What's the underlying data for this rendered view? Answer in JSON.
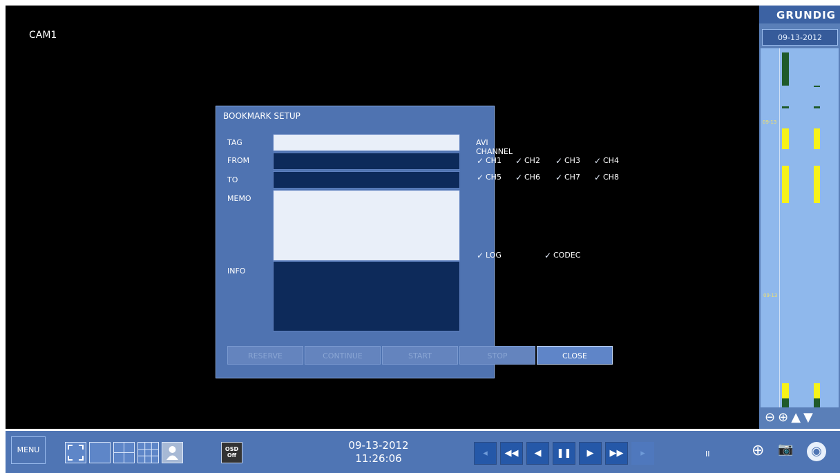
{
  "camera": {
    "label": "CAM1"
  },
  "brand": {
    "name": "GRUNDIG"
  },
  "timeline": {
    "date": "09-13-2012",
    "markers": [
      "09-13",
      "09-13"
    ],
    "controls": {
      "zoom_out": "⊖",
      "zoom_in": "⊕",
      "up": "▲",
      "down": "▼"
    }
  },
  "dialog": {
    "title": "BOOKMARK SETUP",
    "tag_label": "TAG",
    "from_label": "FROM",
    "to_label": "TO",
    "memo_label": "MEMO",
    "info_label": "INFO",
    "avi_channel_label": "AVI CHANNEL",
    "channels": [
      "CH1",
      "CH2",
      "CH3",
      "CH4",
      "CH5",
      "CH6",
      "CH7",
      "CH8"
    ],
    "log_label": "LOG",
    "codec_label": "CODEC",
    "buttons": {
      "reserve": "RESERVE",
      "continue": "CONTINUE",
      "start": "START",
      "stop": "STOP",
      "close": "CLOSE"
    }
  },
  "toolbar": {
    "menu_label": "MENU",
    "osd_label_top": "OSD",
    "osd_label_bottom": "Off",
    "date": "09-13-2012",
    "time": "11:26:06",
    "pause_indicator": "II",
    "playback": {
      "prev_frame": "◂",
      "rewind": "◀◀",
      "step_back": "◀",
      "pause": "❚❚",
      "play": "▶",
      "fast_forward": "▶▶",
      "next_frame": "▸"
    },
    "icons": {
      "zoom": "⊕",
      "camera": "📷",
      "disc": "◉"
    }
  },
  "colors": {
    "accent": "#4f75b4",
    "timeline_bar": "#f7f21a",
    "dark_field": "#0d2a5a"
  }
}
